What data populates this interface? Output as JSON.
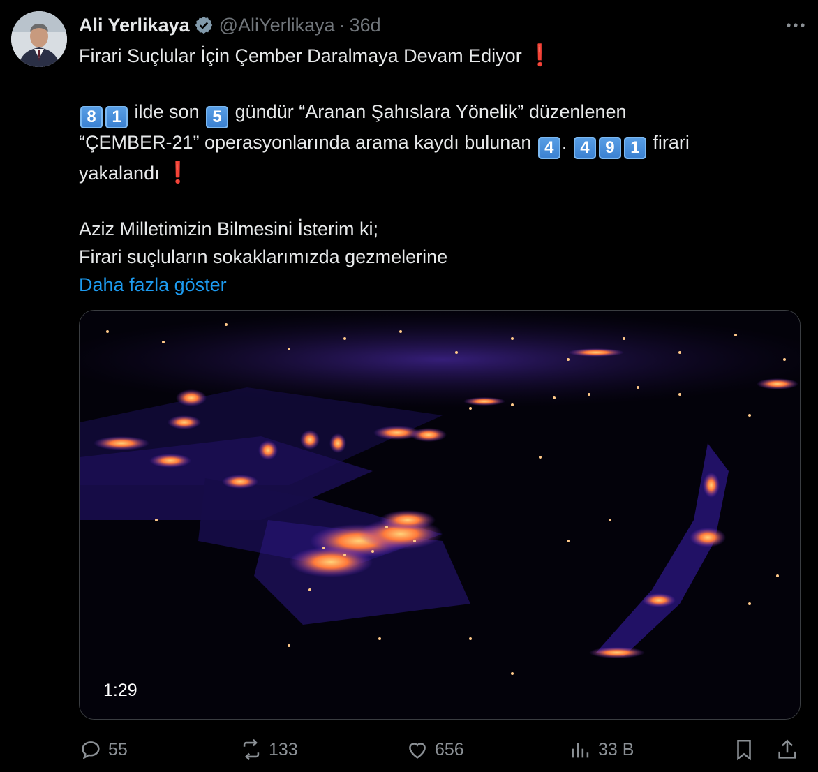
{
  "author": {
    "name": "Ali Yerlikaya",
    "handle": "@AliYerlikaya",
    "separator": "·",
    "time": "36d"
  },
  "tweet": {
    "line1": "Firari Suçlular İçin Çember Daralmaya Devam Ediyor",
    "para2_a": "ilde son",
    "para2_b": "gündür “Aranan Şahıslara Yönelik” düzenlenen",
    "para2_c": "“ÇEMBER-21” operasyonlarında arama kaydı bulunan",
    "para2_d": "firari",
    "para2_e": "yakalandı",
    "num_81": [
      "8",
      "1"
    ],
    "num_5": "5",
    "num_4": "4",
    "num_dot": ".",
    "num_491": [
      "4",
      "9",
      "1"
    ],
    "line4": "Aziz Milletimizin Bilmesini İsterim ki;",
    "line5": "Firari suçluların sokaklarımızda gezmelerine",
    "show_more": "Daha fazla göster",
    "exclamation": "❗"
  },
  "media": {
    "duration": "1:29"
  },
  "actions": {
    "replies": "55",
    "reposts": "133",
    "likes": "656",
    "views": "33 B"
  },
  "icons": [
    "verified-badge-icon",
    "more-icon",
    "reply-icon",
    "repost-icon",
    "like-icon",
    "views-icon",
    "bookmark-icon",
    "share-icon"
  ],
  "colors": {
    "background": "#000000",
    "text": "#e7e9ea",
    "muted": "#71767b",
    "link": "#1d9bf0",
    "keycap": "#3a7fd0"
  }
}
